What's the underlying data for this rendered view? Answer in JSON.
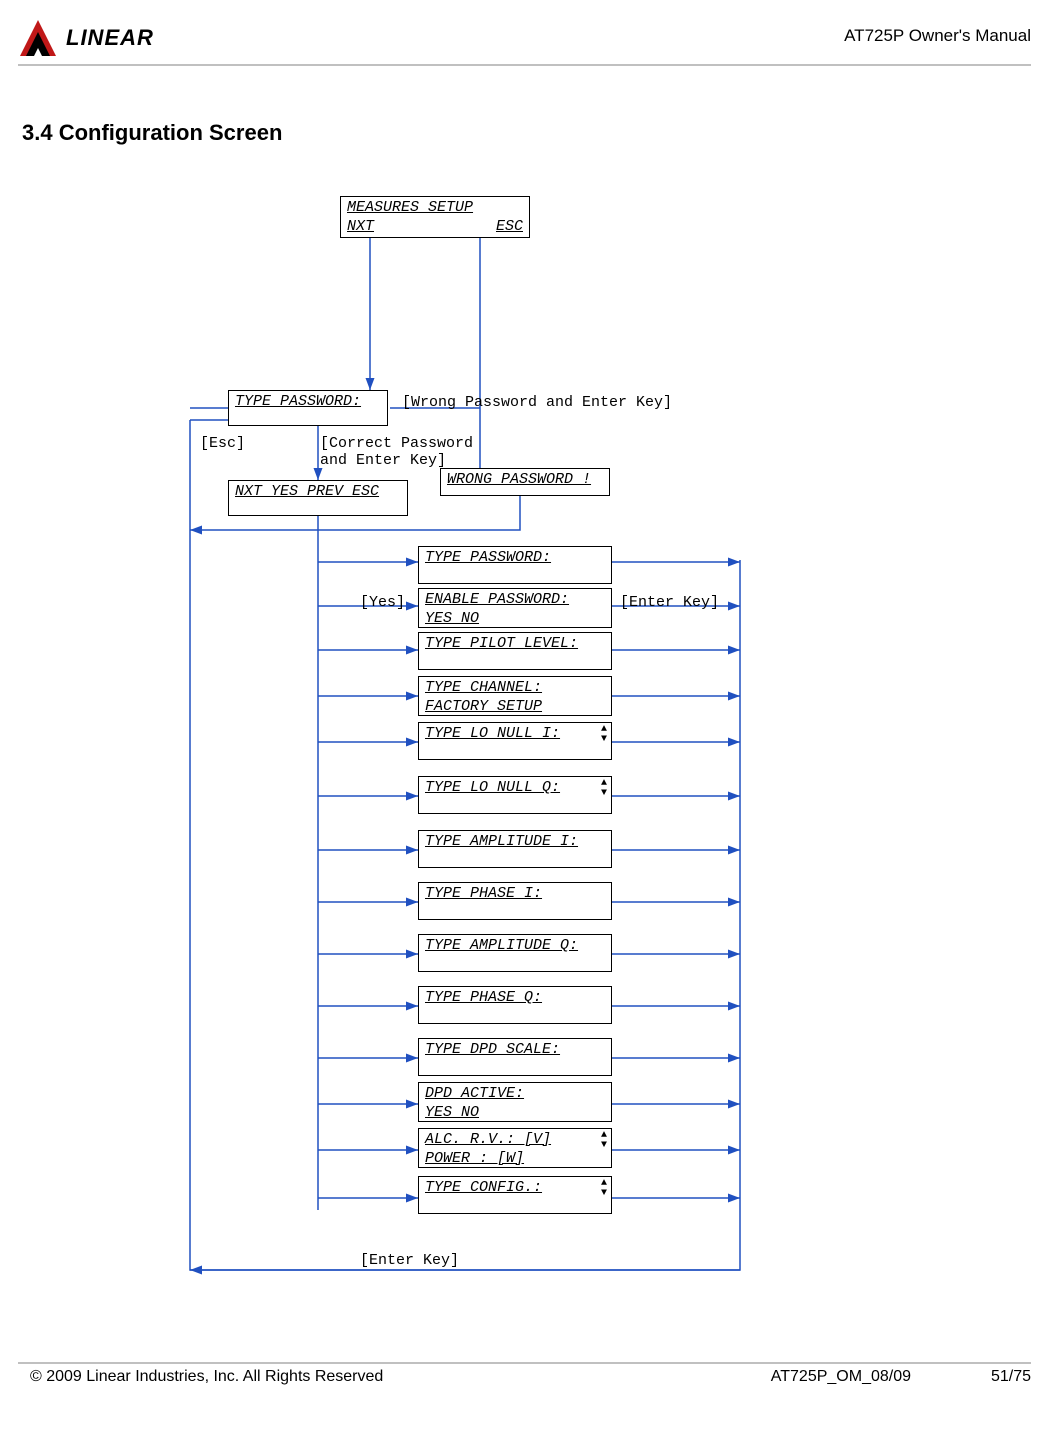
{
  "header": {
    "brand": "LINEAR",
    "doc_title": "AT725P Owner's Manual"
  },
  "section_title": "3.4 Configuration Screen",
  "boxes": {
    "top": {
      "line1": "MEASURES  SETUP",
      "line2_left": "NXT",
      "line2_right": "ESC"
    },
    "type_password": "TYPE PASSWORD:",
    "nav": "NXT  YES  PREV ESC",
    "wrong_password": "WRONG PASSWORD !",
    "list": {
      "i0": "TYPE PASSWORD:",
      "i1_line1": "ENABLE PASSWORD:",
      "i1_line2": "    YES       NO",
      "i2": "TYPE PILOT LEVEL:",
      "i3_line1": "TYPE CHANNEL:",
      "i3_line2": "  FACTORY  SETUP",
      "i4": "TYPE LO NULL I:",
      "i5": "TYPE LO NULL Q:",
      "i6": "TYPE AMPLITUDE I:",
      "i7": "TYPE PHASE I:",
      "i8": "TYPE AMPLITUDE Q:",
      "i9": "TYPE PHASE Q:",
      "i10": "TYPE DPD SCALE:",
      "i11_line1": "DPD ACTIVE:",
      "i11_line2": "    YES       NO",
      "i12_line1": "ALC. R.V.:     [V]",
      "i12_line2": "POWER    :     [W]",
      "i13": "TYPE CONFIG.:"
    }
  },
  "annotations": {
    "wrong_pw_enter": "[Wrong Password and  Enter Key]",
    "esc": "[Esc]",
    "correct_pw_line1": "[Correct Password",
    "correct_pw_line2": " and Enter Key]",
    "yes": "[Yes]",
    "enter_key": "[Enter Key]",
    "enter_key_bottom": "[Enter Key]"
  },
  "footer": {
    "copyright": "© 2009 Linear Industries, Inc.  All Rights Reserved",
    "doc_id": "AT725P_OM_08/09",
    "page_num": "51/75"
  }
}
